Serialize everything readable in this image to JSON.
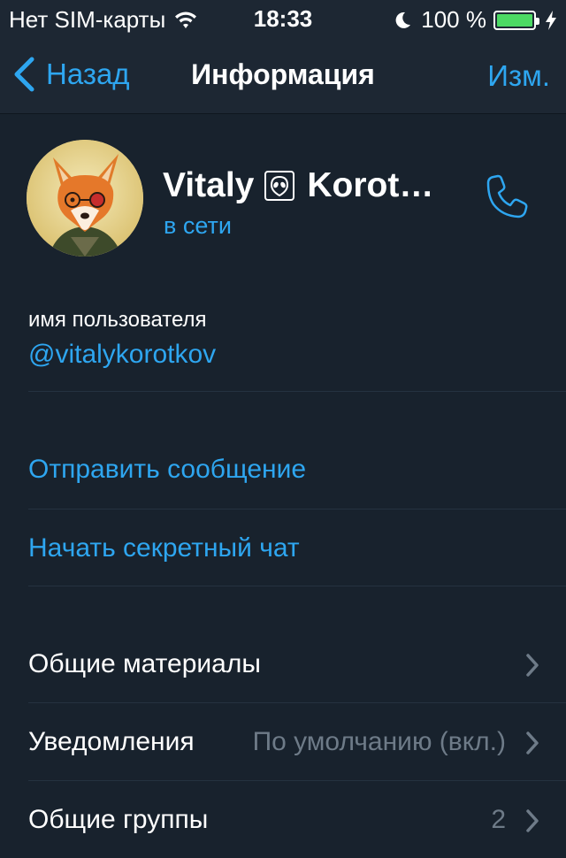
{
  "statusbar": {
    "carrier": "Нет SIM-карты",
    "time": "18:33",
    "battery_text": "100 %",
    "battery_level": 1.0
  },
  "navbar": {
    "back_label": "Назад",
    "title": "Информация",
    "edit_label": "Изм."
  },
  "profile": {
    "first_name": "Vitaly",
    "last_name": "Korot…",
    "status": "в сети"
  },
  "username": {
    "label": "имя пользователя",
    "value": "@vitalykorotkov"
  },
  "actions": {
    "send_message": "Отправить сообщение",
    "secret_chat": "Начать секретный чат"
  },
  "rows": {
    "shared_media": {
      "label": "Общие материалы"
    },
    "notifications": {
      "label": "Уведомления",
      "value": "По умолчанию (вкл.)"
    },
    "common_groups": {
      "label": "Общие группы",
      "value": "2"
    }
  },
  "colors": {
    "accent": "#2ea6f0",
    "background": "#18222d",
    "navbar": "#1d2733",
    "muted": "#6e7b88",
    "battery": "#4cd964"
  },
  "icons": [
    "wifi-icon",
    "moon-icon",
    "battery-icon",
    "charging-bolt-icon",
    "chevron-left-icon",
    "alien-emoji-icon",
    "phone-icon",
    "chevron-right-icon"
  ]
}
